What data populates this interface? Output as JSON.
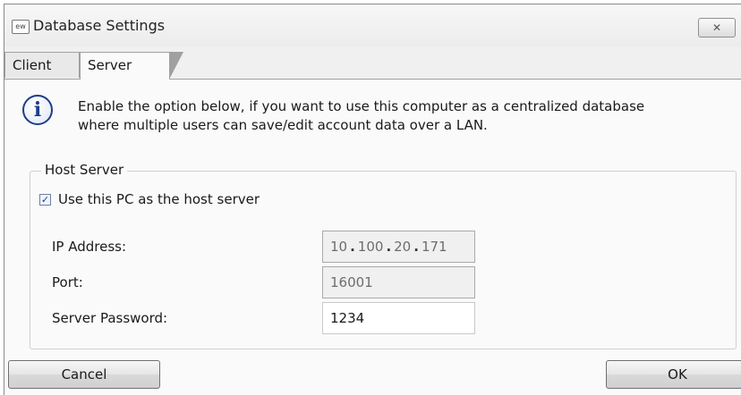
{
  "window": {
    "title": "Database Settings",
    "app_icon_text": "ew",
    "close_label": "✕"
  },
  "tabs": [
    {
      "label": "Client",
      "active": false
    },
    {
      "label": "Server",
      "active": true
    }
  ],
  "info": {
    "icon": "info-icon",
    "text_line1": "Enable the option below, if you want to use this computer as a centralized database",
    "text_line2": "where multiple users can save/edit account data over a LAN."
  },
  "host_server": {
    "legend": "Host Server",
    "checkbox_label": "Use this PC as the host server",
    "checkbox_checked": true,
    "checkbox_mark": "✓",
    "ip_label": "IP Address:",
    "ip_octets": [
      "10",
      "100",
      "20",
      "171"
    ],
    "port_label": "Port:",
    "port_value": "16001",
    "password_label": "Server Password:",
    "password_value": "1234"
  },
  "buttons": {
    "cancel": "Cancel",
    "ok": "OK"
  }
}
